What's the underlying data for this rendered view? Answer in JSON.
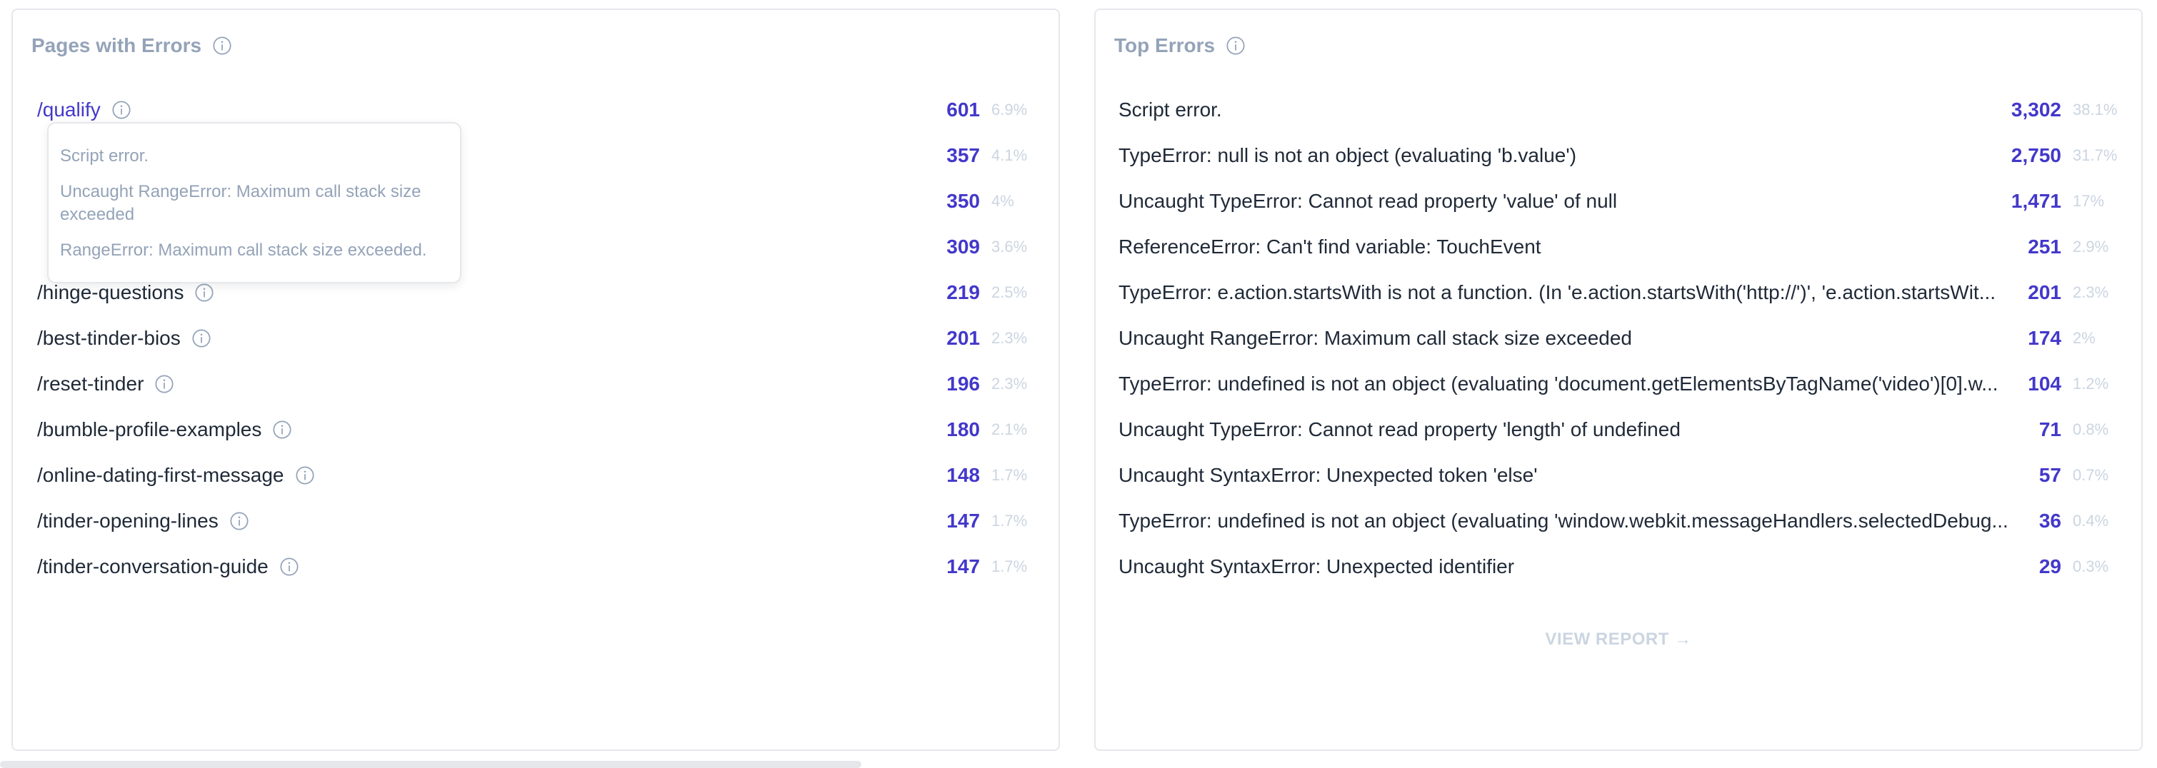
{
  "pages_panel": {
    "title": "Pages with Errors",
    "rows": [
      {
        "label": "/qualify",
        "count": "601",
        "pct": "6.9%"
      },
      {
        "label": "",
        "count": "357",
        "pct": "4.1%"
      },
      {
        "label": "",
        "count": "350",
        "pct": "4%"
      },
      {
        "label": "",
        "count": "309",
        "pct": "3.6%"
      },
      {
        "label": "/hinge-questions",
        "count": "219",
        "pct": "2.5%"
      },
      {
        "label": "/best-tinder-bios",
        "count": "201",
        "pct": "2.3%"
      },
      {
        "label": "/reset-tinder",
        "count": "196",
        "pct": "2.3%"
      },
      {
        "label": "/bumble-profile-examples",
        "count": "180",
        "pct": "2.1%"
      },
      {
        "label": "/online-dating-first-message",
        "count": "148",
        "pct": "1.7%"
      },
      {
        "label": "/tinder-opening-lines",
        "count": "147",
        "pct": "1.7%"
      },
      {
        "label": "/tinder-conversation-guide",
        "count": "147",
        "pct": "1.7%"
      }
    ],
    "tooltip": {
      "items": [
        "Script error.",
        "Uncaught RangeError: Maximum call stack size exceeded",
        "RangeError: Maximum call stack size exceeded."
      ]
    }
  },
  "errors_panel": {
    "title": "Top Errors",
    "rows": [
      {
        "label": "Script error.",
        "count": "3,302",
        "pct": "38.1%"
      },
      {
        "label": "TypeError: null is not an object (evaluating 'b.value')",
        "count": "2,750",
        "pct": "31.7%"
      },
      {
        "label": "Uncaught TypeError: Cannot read property 'value' of null",
        "count": "1,471",
        "pct": "17%"
      },
      {
        "label": "ReferenceError: Can't find variable: TouchEvent",
        "count": "251",
        "pct": "2.9%"
      },
      {
        "label": "TypeError: e.action.startsWith is not a function. (In 'e.action.startsWith('http://')', 'e.action.startsWit...",
        "count": "201",
        "pct": "2.3%"
      },
      {
        "label": "Uncaught RangeError: Maximum call stack size exceeded",
        "count": "174",
        "pct": "2%"
      },
      {
        "label": "TypeError: undefined is not an object (evaluating 'document.getElementsByTagName('video')[0].w...",
        "count": "104",
        "pct": "1.2%"
      },
      {
        "label": "Uncaught TypeError: Cannot read property 'length' of undefined",
        "count": "71",
        "pct": "0.8%"
      },
      {
        "label": "Uncaught SyntaxError: Unexpected token 'else'",
        "count": "57",
        "pct": "0.7%"
      },
      {
        "label": "TypeError: undefined is not an object (evaluating 'window.webkit.messageHandlers.selectedDebug...",
        "count": "36",
        "pct": "0.4%"
      },
      {
        "label": "Uncaught SyntaxError: Unexpected identifier",
        "count": "29",
        "pct": "0.3%"
      }
    ],
    "view_report_label": "VIEW REPORT →"
  },
  "icons": {
    "info": "info-circle-icon"
  },
  "colors": {
    "accent": "#4338ca",
    "muted": "#94a3b8",
    "faint": "#cbd5e1",
    "border": "#e5e7eb"
  }
}
